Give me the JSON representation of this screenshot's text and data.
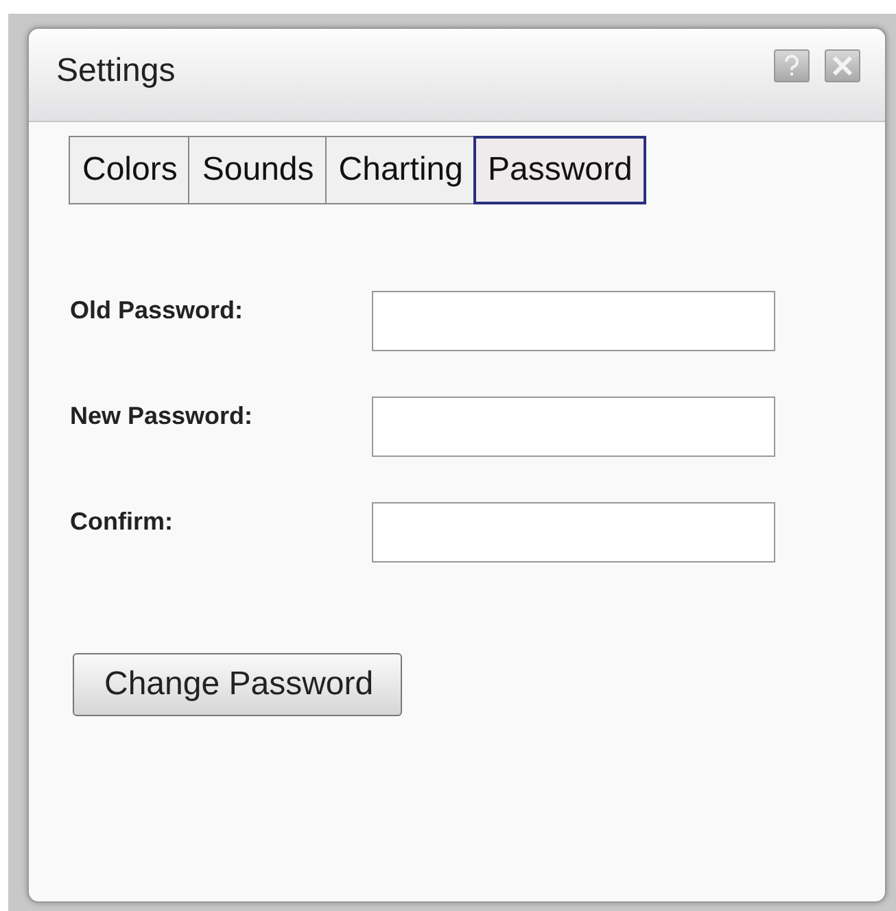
{
  "window": {
    "title": "Settings"
  },
  "tabs": [
    {
      "label": "Colors",
      "selected": false
    },
    {
      "label": "Sounds",
      "selected": false
    },
    {
      "label": "Charting",
      "selected": false
    },
    {
      "label": "Password",
      "selected": true
    }
  ],
  "fields": [
    {
      "label": "Old Password:"
    },
    {
      "label": "New Password:"
    },
    {
      "label": "Confirm:"
    }
  ],
  "buttons": [
    "Change Password"
  ]
}
